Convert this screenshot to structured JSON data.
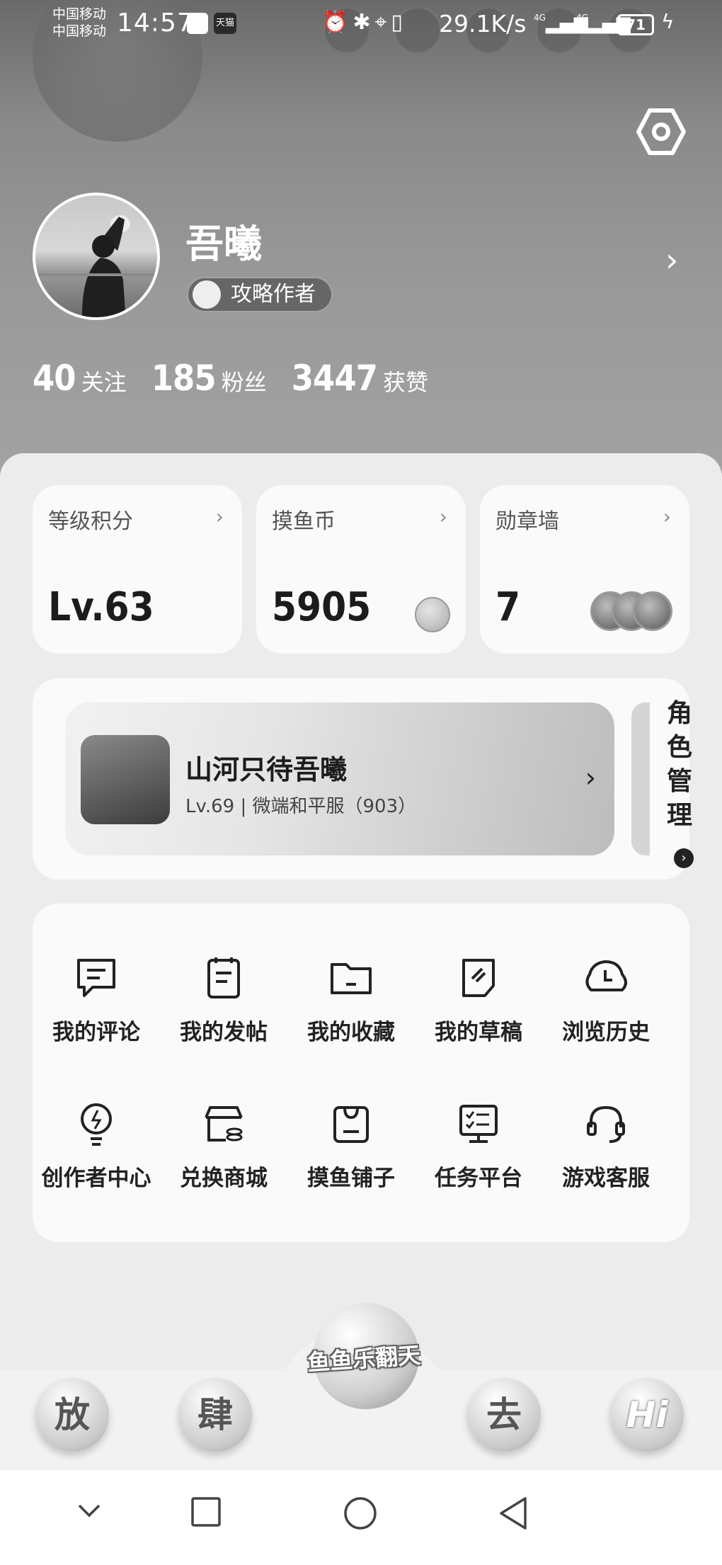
{
  "status_bar": {
    "carrier_1": "中国移动",
    "carrier_2": "中国移动",
    "time": "14:57",
    "app_badge": "天猫",
    "net_speed": "29.1K/s",
    "signal_1": "4G",
    "signal_2": "4G",
    "battery": "71"
  },
  "profile": {
    "name": "吾曦",
    "role_badge": "攻略作者",
    "stats": [
      {
        "value": "40",
        "label": "关注"
      },
      {
        "value": "185",
        "label": "粉丝"
      },
      {
        "value": "3447",
        "label": "获赞"
      }
    ]
  },
  "summary_cards": [
    {
      "label": "等级积分",
      "value": "Lv.63"
    },
    {
      "label": "摸鱼币",
      "value": "5905"
    },
    {
      "label": "勋章墙",
      "value": "7"
    }
  ],
  "game": {
    "title": "山河只待吾曦",
    "subtitle": "Lv.69 | 微端和平服（903）",
    "side_label_chars": [
      "角",
      "色",
      "管",
      "理"
    ]
  },
  "menu": [
    {
      "label": "我的评论",
      "icon": "comment-icon"
    },
    {
      "label": "我的发帖",
      "icon": "post-icon"
    },
    {
      "label": "我的收藏",
      "icon": "folder-icon"
    },
    {
      "label": "我的草稿",
      "icon": "draft-icon"
    },
    {
      "label": "浏览历史",
      "icon": "history-icon"
    },
    {
      "label": "创作者中心",
      "icon": "bulb-icon"
    },
    {
      "label": "兑换商城",
      "icon": "shop-icon"
    },
    {
      "label": "摸鱼铺子",
      "icon": "bag-icon"
    },
    {
      "label": "任务平台",
      "icon": "task-icon"
    },
    {
      "label": "游戏客服",
      "icon": "headset-icon"
    }
  ],
  "tabs": [
    {
      "label": "放"
    },
    {
      "label": "肆"
    },
    {
      "label": "去"
    },
    {
      "label": "Hi"
    }
  ],
  "center_logo": "鱼鱼乐翻天",
  "system_nav": [
    "back-chevron",
    "recents",
    "home",
    "back"
  ]
}
